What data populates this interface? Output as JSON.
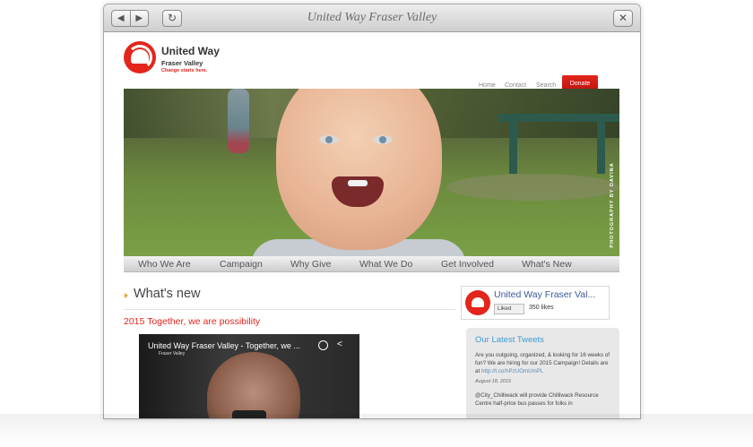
{
  "window": {
    "title": "United Way Fraser Valley",
    "back_glyph": "◀",
    "forward_glyph": "▶",
    "reload_glyph": "↻",
    "close_glyph": "✕"
  },
  "logo": {
    "line1": "United Way",
    "line2": "Fraser Valley",
    "tagline": "Change starts here."
  },
  "topnav": {
    "home": "Home",
    "contact": "Contact",
    "search": "Search",
    "donate": "Donate"
  },
  "hero": {
    "credit": "PHOTOGRAPHY BY DAVINA"
  },
  "mainnav": {
    "items": [
      "Who We Are",
      "Campaign",
      "Why Give",
      "What We Do",
      "Get Involved",
      "What's New"
    ]
  },
  "whats_new": {
    "heading": "What's new",
    "subheading": "2015 Together, we are possibility"
  },
  "video": {
    "title": "United Way Fraser Valley - Together, we ...",
    "channel": "Fraser Valley"
  },
  "facebook": {
    "page_name": "United Way Fraser Val...",
    "like_label": "Liked",
    "likes": "350 likes"
  },
  "tweets": {
    "heading": "Our Latest Tweets",
    "tweet1_text": "Are you outgoing, organized, & looking for 16 weeks of fun? We are hiring for our 2015 Campaign! Details are at",
    "tweet1_link": "http://t.co/hPzUOmUmPL",
    "tweet1_date": "August 18, 2015",
    "tweet2_handle": "@City_Chilliwack",
    "tweet2_text": "will provide Chilliwack Resource Centre half-price bus passes for folks in"
  },
  "colors": {
    "brand_red": "#e3251b",
    "tweet_heading": "#3d9ad6",
    "facebook_blue": "#3b5998"
  }
}
